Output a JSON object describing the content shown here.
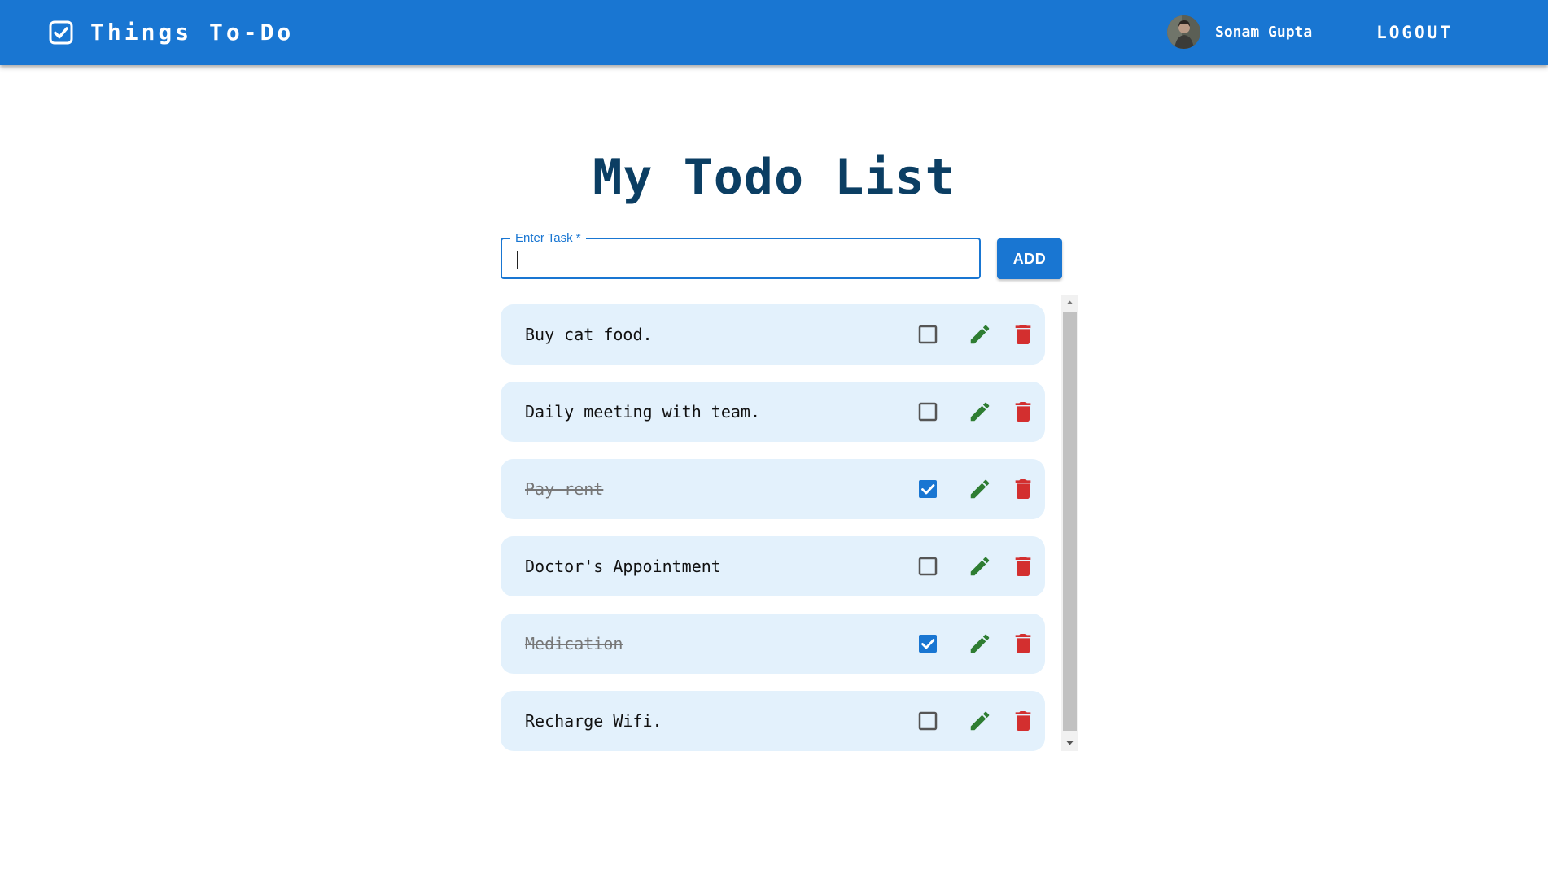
{
  "header": {
    "app_title": "Things To-Do",
    "user_name": "Sonam Gupta",
    "logout_label": "LOGOUT",
    "brand_icon": "checkbox-icon",
    "color": "#1976d2"
  },
  "main": {
    "title": "My Todo List",
    "task_field": {
      "label": "Enter Task *",
      "value": "",
      "placeholder": ""
    },
    "add_label": "ADD"
  },
  "todos": [
    {
      "text": "Buy cat food.",
      "completed": false
    },
    {
      "text": "Daily meeting with team.",
      "completed": false
    },
    {
      "text": "Pay rent",
      "completed": true
    },
    {
      "text": "Doctor's Appointment",
      "completed": false
    },
    {
      "text": "Medication",
      "completed": true
    },
    {
      "text": "Recharge Wifi.",
      "completed": false
    }
  ],
  "icons": {
    "edit": "pencil-icon",
    "delete": "trash-icon",
    "check": "checkbox-icon"
  },
  "colors": {
    "accent": "#1976d2",
    "edit": "#2e7d32",
    "delete": "#d32f2f",
    "item_bg": "#e3f1fc",
    "title": "#0b3e63"
  }
}
